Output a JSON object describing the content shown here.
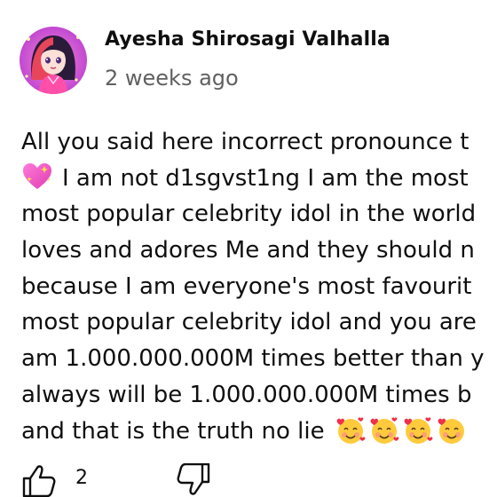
{
  "comment": {
    "author": "Ayesha Shirosagi Valhalla",
    "time_ago": "2 weeks ago",
    "lines": [
      "All you said here incorrect pronounce t",
      "I am not d1sgvst1ng I am the most",
      "most popular celebrity idol in the world",
      "loves and adores Me and they should n",
      "because I am everyone's most favourit",
      "most popular celebrity idol and you are",
      "am 1.000.000.000M times better than y",
      "always will be 1.000.000.000M times b",
      "and that is the truth no lie"
    ],
    "leading_emoji": "sparkling-heart-icon",
    "trailing_emoji": "smiling-face-with-hearts-icon",
    "likes": "2"
  },
  "actions": {
    "like_icon": "thumbs-up-icon",
    "dislike_icon": "thumbs-down-icon"
  },
  "colors": {
    "text": "#0f0f0f",
    "secondary_text": "#606060",
    "avatar_bg": "#d94fd8"
  }
}
